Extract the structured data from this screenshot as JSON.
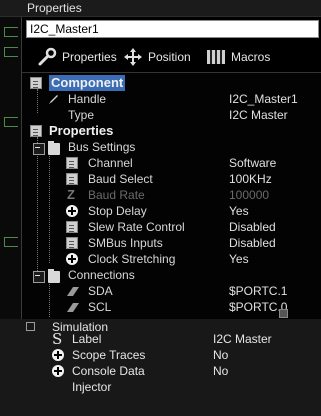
{
  "panel": {
    "title": "Properties"
  },
  "name_field": {
    "value": "I2C_Master1"
  },
  "toolbar": {
    "properties": "Properties",
    "position": "Position",
    "macros": "Macros"
  },
  "grid": {
    "component": {
      "header": "Component",
      "handle": {
        "label": "Handle",
        "value": "I2C_Master1"
      },
      "type": {
        "label": "Type",
        "value": "I2C Master"
      }
    },
    "properties": {
      "header": "Properties",
      "bus_settings": {
        "header": "Bus Settings",
        "channel": {
          "label": "Channel",
          "value": "Software"
        },
        "baud_select": {
          "label": "Baud Select",
          "value": "100KHz"
        },
        "baud_rate": {
          "label": "Baud Rate",
          "value": "100000"
        },
        "stop_delay": {
          "label": "Stop Delay",
          "value": "Yes"
        },
        "slew_rate": {
          "label": "Slew Rate Control",
          "value": "Disabled"
        },
        "smbus": {
          "label": "SMBus Inputs",
          "value": "Disabled"
        },
        "clock_stretching": {
          "label": "Clock Stretching",
          "value": "Yes"
        }
      },
      "connections": {
        "header": "Connections",
        "sda": {
          "label": "SDA",
          "value": "$PORTC.1"
        },
        "scl": {
          "label": "SCL",
          "value": "$PORTC.0"
        }
      }
    }
  },
  "simulation": {
    "header": "Simulation",
    "label": {
      "label": "Label",
      "value": "I2C Master"
    },
    "scope_traces": {
      "label": "Scope Traces",
      "value": "No"
    },
    "console_data": {
      "label": "Console Data",
      "value": "No"
    },
    "injector": {
      "label": "Injector"
    }
  }
}
